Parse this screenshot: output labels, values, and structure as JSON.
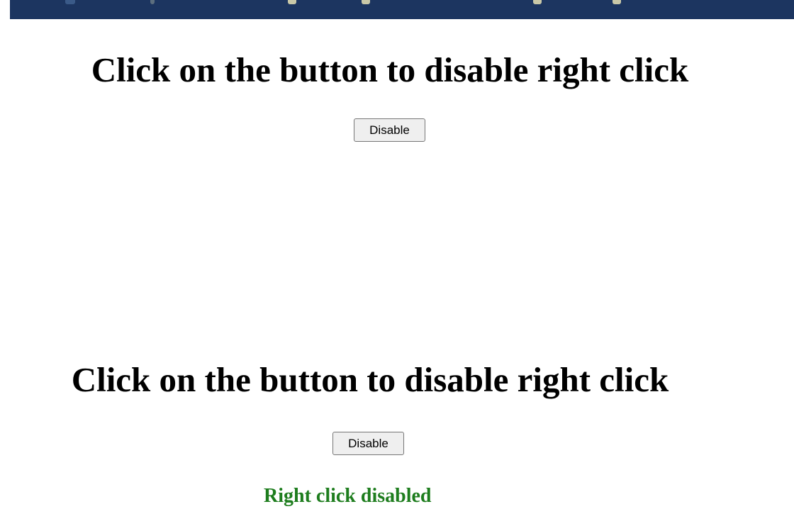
{
  "colors": {
    "top_bar": "#1c3560",
    "top_bar_marks": [
      "#3a5a88",
      "#5c6e7e",
      "#c9c8a8",
      "#c9c8a8",
      "#c9c8a8",
      "#c9c8a8"
    ],
    "status_text": "#1e7d1e"
  },
  "first_section": {
    "heading": "Click on the button to disable right click",
    "button_label": "Disable"
  },
  "second_section": {
    "heading": "Click on the button to disable right click",
    "button_label": "Disable",
    "status_message": "Right click disabled"
  }
}
